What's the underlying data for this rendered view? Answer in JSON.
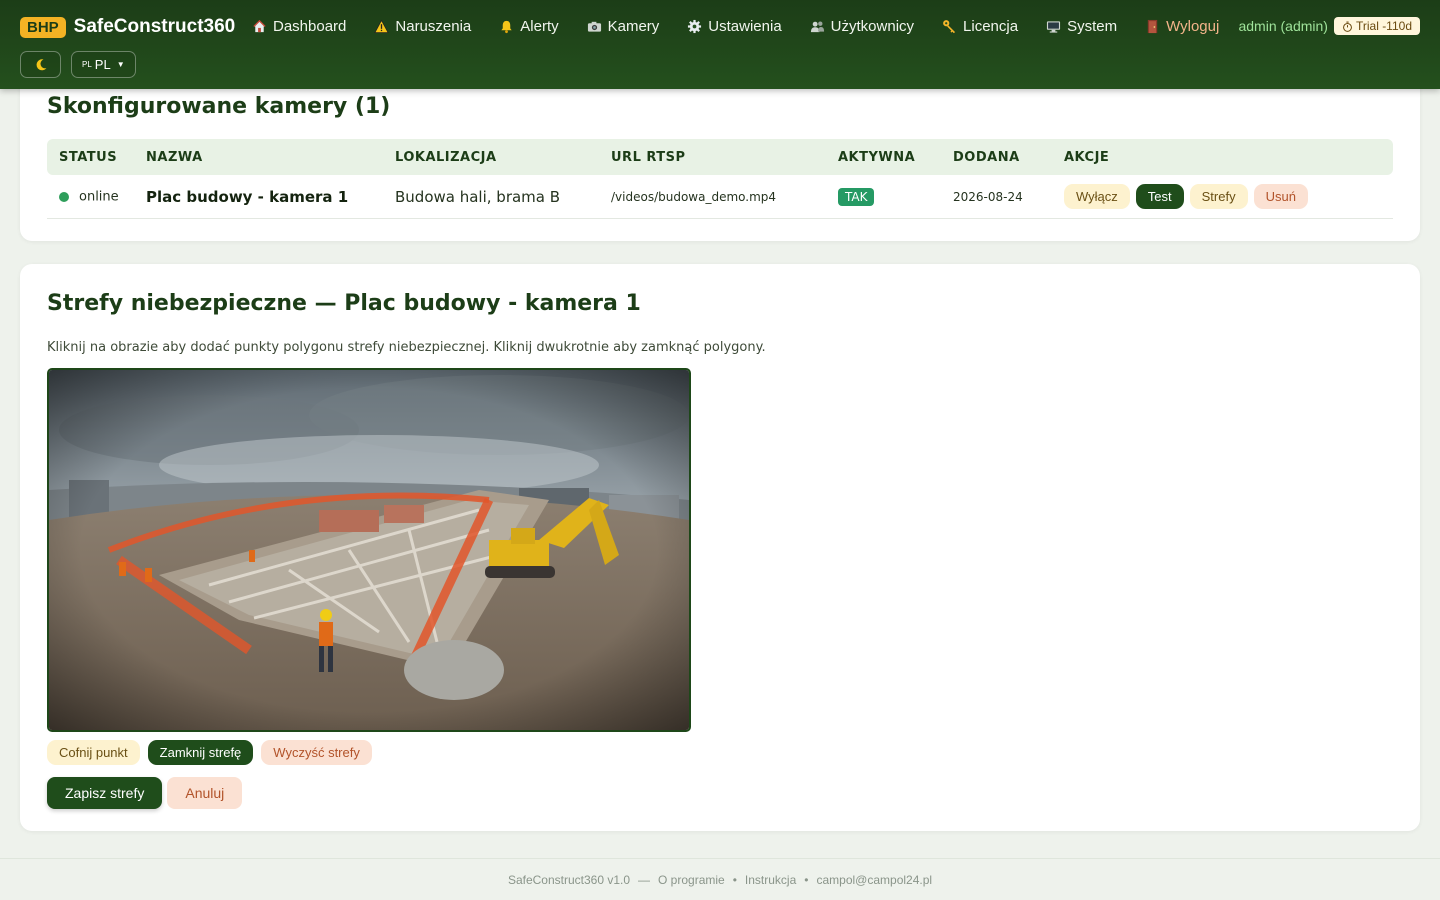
{
  "header": {
    "brand_badge": "BHP",
    "brand_name": "SafeConstruct360",
    "nav": [
      {
        "label": "Dashboard",
        "icon": "house-icon"
      },
      {
        "label": "Naruszenia",
        "icon": "warning-icon"
      },
      {
        "label": "Alerty",
        "icon": "bell-icon"
      },
      {
        "label": "Kamery",
        "icon": "camera-icon"
      },
      {
        "label": "Ustawienia",
        "icon": "gear-icon"
      },
      {
        "label": "Użytkownicy",
        "icon": "users-icon"
      },
      {
        "label": "Licencja",
        "icon": "key-icon"
      },
      {
        "label": "System",
        "icon": "monitor-icon"
      },
      {
        "label": "Wyloguj",
        "icon": "door-icon"
      }
    ],
    "user": "admin (admin)",
    "trial": "Trial -110d",
    "theme_icon": "moon-icon",
    "lang_small": "PL",
    "lang": "PL"
  },
  "cameras": {
    "title": "Skonfigurowane kamery (1)",
    "columns": [
      "STATUS",
      "NAZWA",
      "LOKALIZACJA",
      "URL RTSP",
      "AKTYWNA",
      "DODANA",
      "AKCJE"
    ],
    "rows": [
      {
        "status": "online",
        "name": "Plac budowy - kamera 1",
        "location": "Budowa hali, brama B",
        "url": "/videos/budowa_demo.mp4",
        "active": "TAK",
        "added": "2026-08-24",
        "actions": [
          "Wyłącz",
          "Test",
          "Strefy",
          "Usuń"
        ]
      }
    ]
  },
  "zones": {
    "title": "Strefy niebezpieczne — Plac budowy - kamera 1",
    "description": "Kliknij na obrazie aby dodać punkty polygonu strefy niebezpiecznej. Kliknij dwukrotnie aby zamknąć polygony.",
    "btn_undo": "Cofnij punkt",
    "btn_close": "Zamknij strefę",
    "btn_clear": "Wyczyść strefy",
    "btn_save": "Zapisz strefy",
    "btn_cancel": "Anuluj"
  },
  "footer": {
    "version": "SafeConstruct360 v1.0",
    "sep": "—",
    "about": "O programie",
    "dot": "•",
    "manual": "Instrukcja",
    "email": "campol@campol24.pl"
  },
  "colors": {
    "header_bg": "#1c3d17",
    "accent_dark": "#1f4d1b",
    "badge": "#f4b324",
    "online": "#2e9e5b",
    "danger_bg": "#fbe1d3",
    "warn_bg": "#fdf2cf"
  }
}
